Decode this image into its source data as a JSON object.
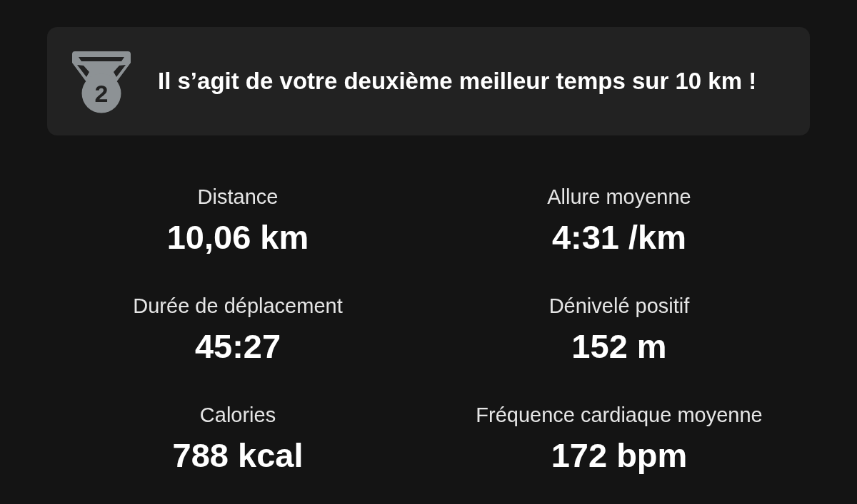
{
  "banner": {
    "rank": "2",
    "message": "Il s’agit de votre deuxième meilleur temps sur 10 km !"
  },
  "stats": [
    {
      "label": "Distance",
      "value": "10,06 km"
    },
    {
      "label": "Allure moyenne",
      "value": "4:31 /km"
    },
    {
      "label": "Durée de déplacement",
      "value": "45:27"
    },
    {
      "label": "Dénivelé positif",
      "value": "152 m"
    },
    {
      "label": "Calories",
      "value": "788 kcal"
    },
    {
      "label": "Fréquence cardiaque moyenne",
      "value": "172 bpm"
    }
  ]
}
